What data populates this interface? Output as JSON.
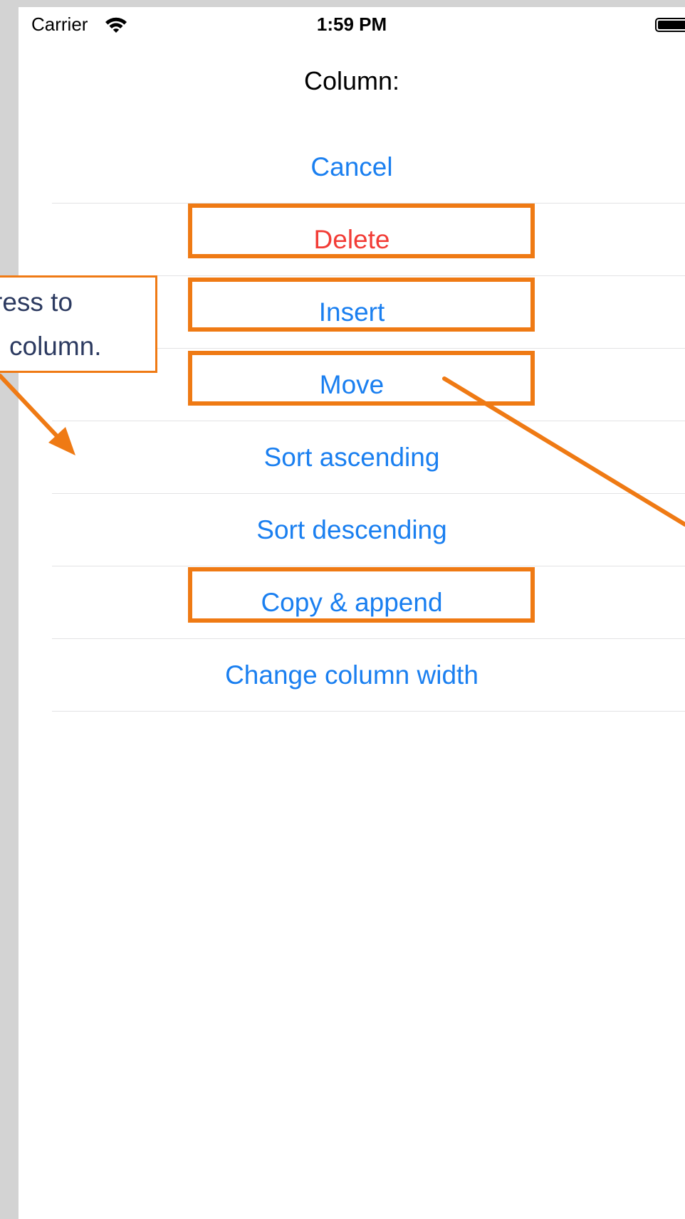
{
  "status_bar": {
    "carrier": "Carrier",
    "time": "1:59 PM",
    "icons": [
      "wifi-icon",
      "battery-icon"
    ]
  },
  "action_sheet": {
    "title": "Column:",
    "items": [
      {
        "label": "Cancel",
        "style": "default"
      },
      {
        "label": "Delete",
        "style": "destructive"
      },
      {
        "label": "Insert",
        "style": "default"
      },
      {
        "label": "Move",
        "style": "default"
      },
      {
        "label": "Sort ascending",
        "style": "default"
      },
      {
        "label": "Sort descending",
        "style": "default"
      },
      {
        "label": "Copy & append",
        "style": "default"
      },
      {
        "label": "Change column width",
        "style": "default"
      }
    ]
  },
  "annotation": {
    "callout_line1": "ress to",
    "callout_line2": "column.",
    "highlighted_items": [
      "Delete",
      "Insert",
      "Move",
      "Copy & append"
    ]
  },
  "colors": {
    "accent": "#1a7ff0",
    "destructive": "#f23c36",
    "annotation": "#ef7a14",
    "callout_text": "#2c3a60",
    "background": "#d3d3d3"
  }
}
